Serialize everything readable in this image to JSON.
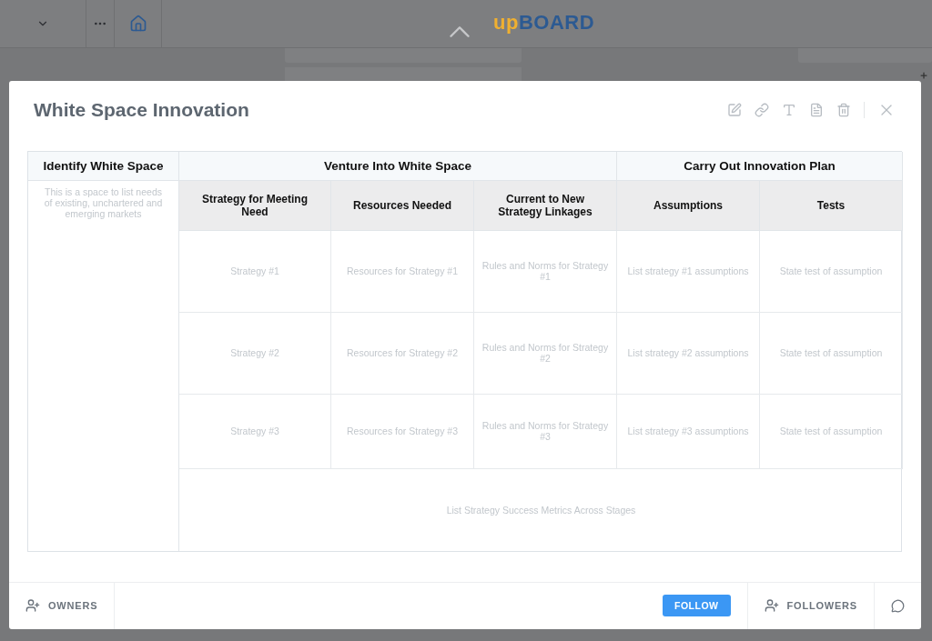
{
  "app_bar": {
    "logo_prefix": "up",
    "logo_suffix": "BOARD"
  },
  "modal": {
    "title": "White Space Innovation"
  },
  "table": {
    "groups": [
      {
        "label": "Identify White Space"
      },
      {
        "label": "Venture Into White Space"
      },
      {
        "label": "Carry Out Innovation Plan"
      }
    ],
    "side_note": "This is a space to list needs of existing, unchartered and emerging markets",
    "columns": [
      "Strategy for Meeting Need",
      "Resources Needed",
      "Current to New Strategy Linkages",
      "Assumptions",
      "Tests"
    ],
    "rows": [
      [
        "Strategy #1",
        "Resources for Strategy #1",
        "Rules and Norms for Strategy #1",
        "List strategy #1 assumptions",
        "State test of assumption"
      ],
      [
        "Strategy #2",
        "Resources for Strategy #2",
        "Rules and Norms for Strategy #2",
        "List strategy #2 assumptions",
        "State test of assumption"
      ],
      [
        "Strategy #3",
        "Resources for Strategy #3",
        "Rules and Norms for Strategy #3",
        "List strategy #3 assumptions",
        "State test of assumption"
      ]
    ],
    "metrics": "List Strategy Success Metrics Across Stages"
  },
  "footer": {
    "owners": "OWNERS",
    "follow": "FOLLOW",
    "followers": "FOLLOWERS"
  }
}
